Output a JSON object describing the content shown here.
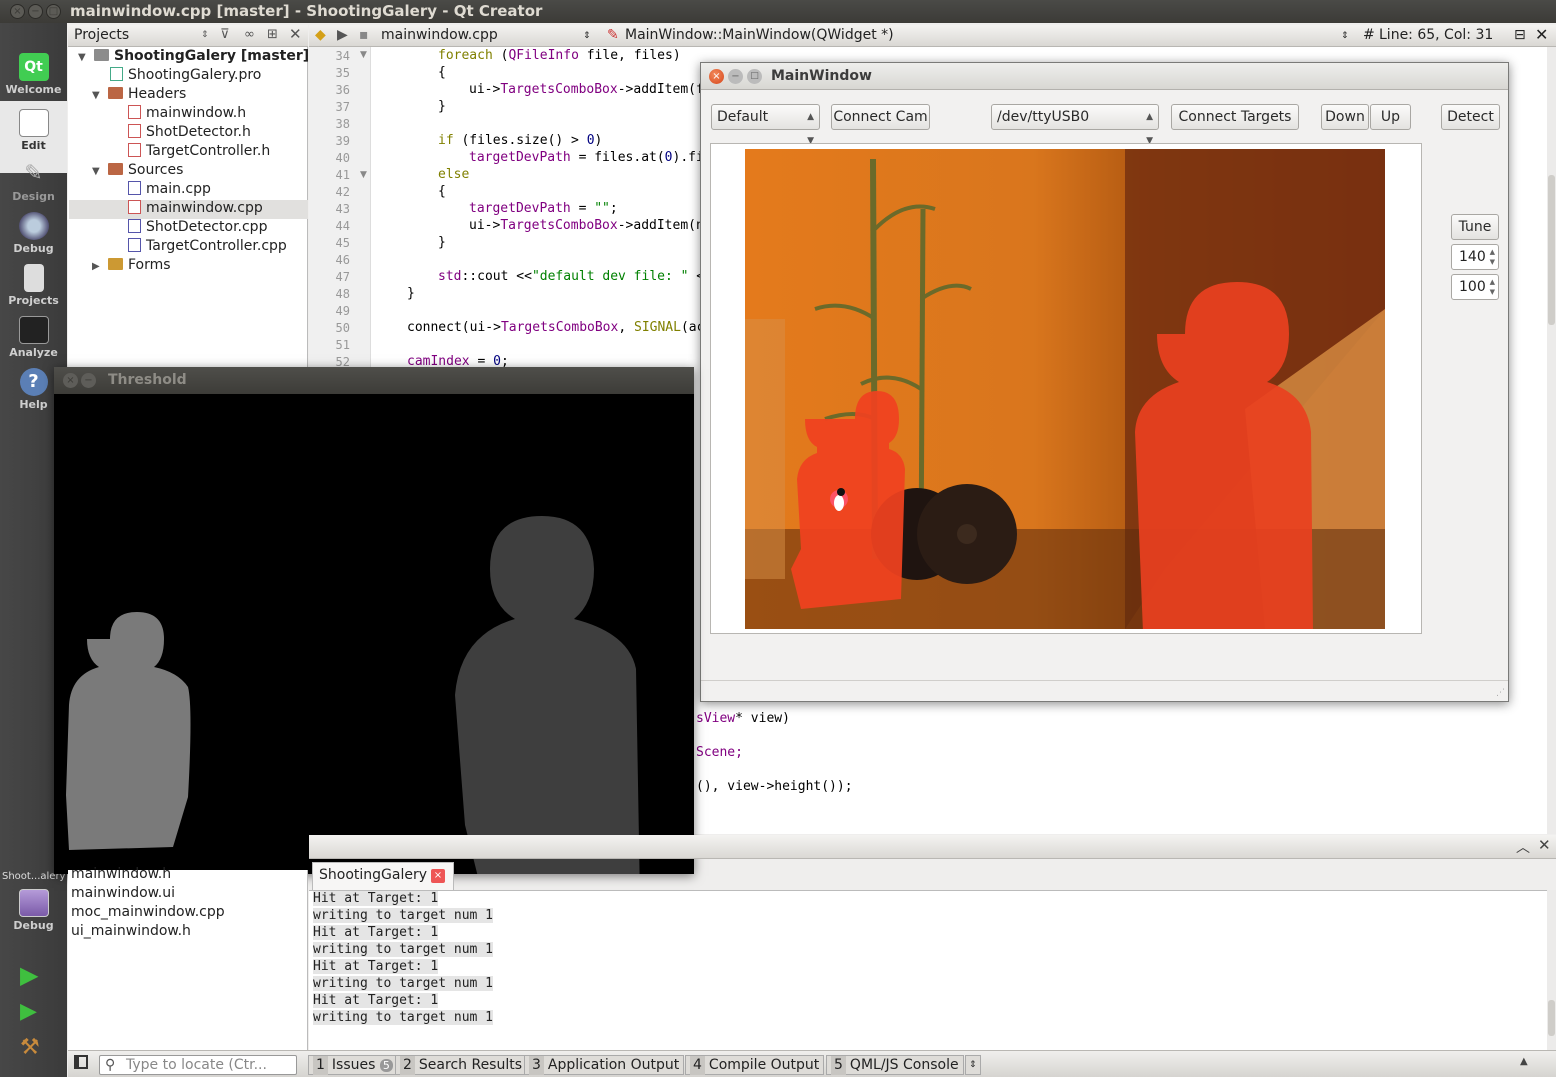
{
  "window": {
    "title": "mainwindow.cpp [master] - ShootingGalery - Qt Creator"
  },
  "modes": [
    {
      "label": "Welcome",
      "icon": "qt-logo-icon"
    },
    {
      "label": "Edit",
      "icon": "edit-icon"
    },
    {
      "label": "Design",
      "icon": "design-icon"
    },
    {
      "label": "Debug",
      "icon": "debug-icon"
    },
    {
      "label": "Projects",
      "icon": "projects-icon"
    },
    {
      "label": "Analyze",
      "icon": "analyze-icon"
    },
    {
      "label": "Help",
      "icon": "help-icon"
    }
  ],
  "kit": {
    "label": "Shoot...alery",
    "mode": "Debug"
  },
  "projects": {
    "header": "Projects",
    "tree": {
      "root": "ShootingGalery [master]",
      "pro": "ShootingGalery.pro",
      "headers": "Headers",
      "h1": "mainwindow.h",
      "h2": "ShotDetector.h",
      "h3": "TargetController.h",
      "sources": "Sources",
      "s1": "main.cpp",
      "s2": "mainwindow.cpp",
      "s3": "ShotDetector.cpp",
      "s4": "TargetController.cpp",
      "forms": "Forms"
    }
  },
  "editor": {
    "file": "mainwindow.cpp",
    "symbol": "MainWindow::MainWindow(QWidget *)",
    "hash": "#",
    "position": "Line: 65, Col: 31",
    "lines": {
      "l34": "34",
      "l35": "35",
      "l36": "36",
      "l37": "37",
      "l38": "38",
      "l39": "39",
      "l40": "40",
      "l41": "41",
      "l42": "42",
      "l43": "43",
      "l44": "44",
      "l45": "45",
      "l46": "46",
      "l47": "47",
      "l48": "48",
      "l49": "49",
      "l50": "50",
      "l51": "51",
      "l52": "52"
    },
    "code": {
      "c34a": "foreach ",
      "c34b": "(",
      "c34c": "QFileInfo",
      "c34d": " file, files)",
      "c35": "{",
      "c36a": "ui->",
      "c36b": "TargetsComboBox",
      "c36c": "->addItem(f",
      "c37": "}",
      "c39a": "if",
      "c39b": " (files.size() > ",
      "c39c": "0",
      "c39d": ")",
      "c40a": "targetDevPath",
      "c40b": " = files.at(",
      "c40c": "0",
      "c40d": ").fi",
      "c41": "else",
      "c42": "{",
      "c43a": "targetDevPath",
      "c43b": " = ",
      "c43c": "\"\"",
      "c43d": ";",
      "c44a": "ui->",
      "c44b": "TargetsComboBox",
      "c44c": "->addItem(n",
      "c45": "}",
      "c47a": "std",
      "c47b": "::cout <<",
      "c47c": "\"default dev file: \"",
      "c47d": " <",
      "c48": "}",
      "c50a": "connect(",
      "c50b": "ui->",
      "c50c": "TargetsComboBox",
      "c50d": ", ",
      "c50e": "SIGNAL",
      "c50f": "(ac",
      "c52a": "camIndex",
      "c52b": " = ",
      "c52c": "0",
      "c52d": ";",
      "r1a": "sView",
      "r1b": "* view)",
      "r2": "Scene;",
      "r3": "(), view->height());"
    }
  },
  "mainwindow": {
    "title": "MainWindow",
    "cam_combo": "Default",
    "connect_cam": "Connect Cam",
    "port_combo": "/dev/ttyUSB0",
    "connect_targets": "Connect Targets",
    "down": "Down",
    "up": "Up",
    "detect": "Detect",
    "tune": "Tune",
    "spin1": "140",
    "spin2": "100"
  },
  "threshold": {
    "title": "Threshold"
  },
  "left_bottom": {
    "items": [
      "mainwindow.h",
      "mainwindow.ui",
      "moc_mainwindow.cpp",
      "ui_mainwindow.h"
    ]
  },
  "output": {
    "tab": "ShootingGalery",
    "lines": [
      "Hit at Target: 1",
      "writing to target num 1",
      "Hit at Target: 1",
      "writing to target num 1",
      "Hit at Target: 1",
      "writing to target num 1",
      "Hit at Target: 1",
      "writing to target num 1"
    ]
  },
  "statusbar": {
    "locator_placeholder": "Type to locate (Ctr...",
    "panes": [
      {
        "num": "1",
        "label": "Issues",
        "badge": "5"
      },
      {
        "num": "2",
        "label": "Search Results"
      },
      {
        "num": "3",
        "label": "Application Output"
      },
      {
        "num": "4",
        "label": "Compile Output"
      },
      {
        "num": "5",
        "label": "QML/JS Console"
      }
    ]
  },
  "colors": {
    "accent_ubuntu_close": "#e05a2b",
    "target_orange": "#e8502a",
    "threshold_gray_light": "#7a7a7a",
    "threshold_gray_dark": "#3e3e3e"
  }
}
